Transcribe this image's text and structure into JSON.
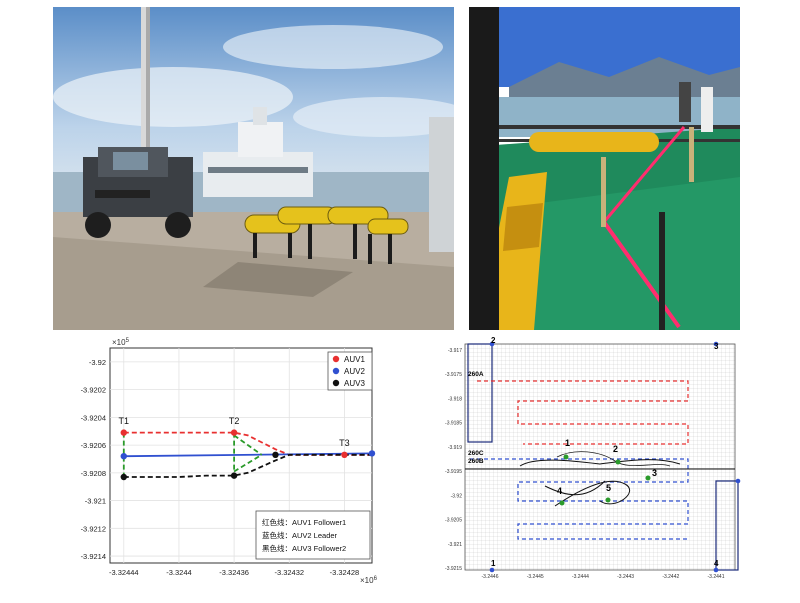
{
  "chart_data": [
    {
      "type": "line",
      "xlabel_multiplier": "×10",
      "xlabel_multiplier_exp": "6",
      "ylabel_multiplier": "×10",
      "ylabel_multiplier_exp": "5",
      "xlim": [
        -3.32445,
        -3.32426
      ],
      "ylim": [
        -3.92145,
        -3.9199
      ],
      "x_ticks": [
        -3.32444,
        -3.3244,
        -3.32436,
        -3.32432,
        -3.32428
      ],
      "x_tick_labels": [
        "-3.32444",
        "-3.3244",
        "-3.32436",
        "-3.32432",
        "-3.32428"
      ],
      "y_ticks": [
        -3.92,
        -3.9202,
        -3.9204,
        -3.9206,
        -3.9208,
        -3.921,
        -3.9212,
        -3.9214
      ],
      "y_tick_labels": [
        "-3.92",
        "-3.9202",
        "-3.9204",
        "-3.9206",
        "-3.9208",
        "-3.921",
        "-3.9212",
        "-3.9214"
      ],
      "grid": true,
      "legend_position": "top-right",
      "legend": [
        {
          "name": "AUV1",
          "color": "#e83030"
        },
        {
          "name": "AUV2",
          "color": "#3050d0"
        },
        {
          "name": "AUV3",
          "color": "#111111"
        }
      ],
      "legend_notes": [
        "红色线：AUV1 Follower1",
        "蓝色线：AUV2 Leader",
        "黑色线：AUV3 Follower2"
      ],
      "series": [
        {
          "color": "#e83030",
          "dash": true,
          "x": [
            -3.32444,
            -3.3244,
            -3.32438,
            -3.32436,
            -3.32435,
            -3.32433,
            -3.32432,
            -3.32426
          ],
          "y": [
            -3.92051,
            -3.92051,
            -3.92051,
            -3.92051,
            -3.92053,
            -3.92063,
            -3.92067,
            -3.92067
          ]
        },
        {
          "color": "#3050d0",
          "dash": false,
          "x": [
            -3.32444,
            -3.32426
          ],
          "y": [
            -3.92068,
            -3.92066
          ]
        },
        {
          "color": "#111111",
          "dash": true,
          "x": [
            -3.32444,
            -3.3244,
            -3.32438,
            -3.32436,
            -3.32435,
            -3.32433,
            -3.32432,
            -3.32426
          ],
          "y": [
            -3.92083,
            -3.92083,
            -3.92082,
            -3.92082,
            -3.9208,
            -3.92071,
            -3.92067,
            -3.92067
          ]
        },
        {
          "color": "#2a9a2a",
          "dash": true,
          "x": [
            -3.32436,
            -3.32436,
            -3.32436
          ],
          "y": [
            -3.92051,
            -3.92067,
            -3.92082
          ]
        },
        {
          "color": "#2a9a2a",
          "dash": true,
          "x": [
            -3.32444,
            -3.32444
          ],
          "y": [
            -3.92051,
            -3.92083
          ]
        },
        {
          "color": "#2a9a2a",
          "dash": true,
          "x": [
            -3.32436,
            -3.32434
          ],
          "y": [
            -3.92053,
            -3.92067
          ]
        },
        {
          "color": "#2a9a2a",
          "dash": true,
          "x": [
            -3.32436,
            -3.32434
          ],
          "y": [
            -3.92079,
            -3.92067
          ]
        }
      ],
      "markers": [
        {
          "color": "#e83030",
          "x": -3.32444,
          "y": -3.92051
        },
        {
          "color": "#e83030",
          "x": -3.32436,
          "y": -3.92051
        },
        {
          "color": "#e83030",
          "x": -3.32428,
          "y": -3.92067
        },
        {
          "color": "#3050d0",
          "x": -3.32444,
          "y": -3.92068
        },
        {
          "color": "#3050d0",
          "x": -3.32426,
          "y": -3.92066
        },
        {
          "color": "#111111",
          "x": -3.32444,
          "y": -3.92083
        },
        {
          "color": "#111111",
          "x": -3.32436,
          "y": -3.92082
        },
        {
          "color": "#111111",
          "x": -3.32433,
          "y": -3.92067
        }
      ],
      "annotations": [
        {
          "text": "T1",
          "x": -3.32444,
          "y": -3.92049
        },
        {
          "text": "T2",
          "x": -3.32436,
          "y": -3.92049
        },
        {
          "text": "T3",
          "x": -3.32428,
          "y": -3.92065
        }
      ]
    },
    {
      "type": "line",
      "title": "",
      "x_tick_labels": [
        "-3.2446",
        "-3.2445",
        "-3.2444",
        "-3.2443",
        "-3.2442",
        "-3.2441"
      ],
      "y_tick_labels": [
        "-3.917",
        "-3.9175",
        "-3.918",
        "-3.9185",
        "-3.919",
        "-3.9195",
        "-3.92",
        "-3.9205",
        "-3.921",
        "-3.9215"
      ],
      "grid": true,
      "corner_labels": [
        "1",
        "2",
        "3",
        "4"
      ],
      "region_labels": [
        "260A",
        "260C",
        "260B"
      ],
      "point_labels": [
        "1",
        "2",
        "3",
        "4",
        "5"
      ]
    }
  ]
}
